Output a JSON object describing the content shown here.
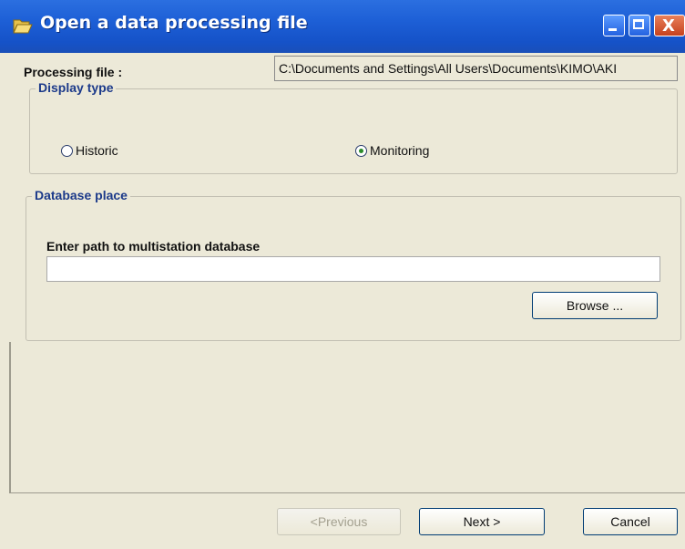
{
  "window": {
    "title": "Open a data processing file",
    "title_icon": "open-folder-icon",
    "controls": {
      "minimize": "minimize-icon",
      "maximize": "maximize-icon",
      "close": "X"
    }
  },
  "processing_file": {
    "label": "Processing file :",
    "value": "C:\\Documents and Settings\\All Users\\Documents\\KIMO\\AKI"
  },
  "display_type": {
    "title": "Display type",
    "options": [
      {
        "label": "Historic",
        "checked": false
      },
      {
        "label": "Monitoring",
        "checked": true
      }
    ]
  },
  "database_place": {
    "title": "Database place",
    "path_label": "Enter path to multistation database",
    "path_value": "",
    "browse_label": "Browse ..."
  },
  "footer": {
    "previous_label": "<Previous",
    "next_label": "Next >",
    "cancel_label": "Cancel"
  }
}
